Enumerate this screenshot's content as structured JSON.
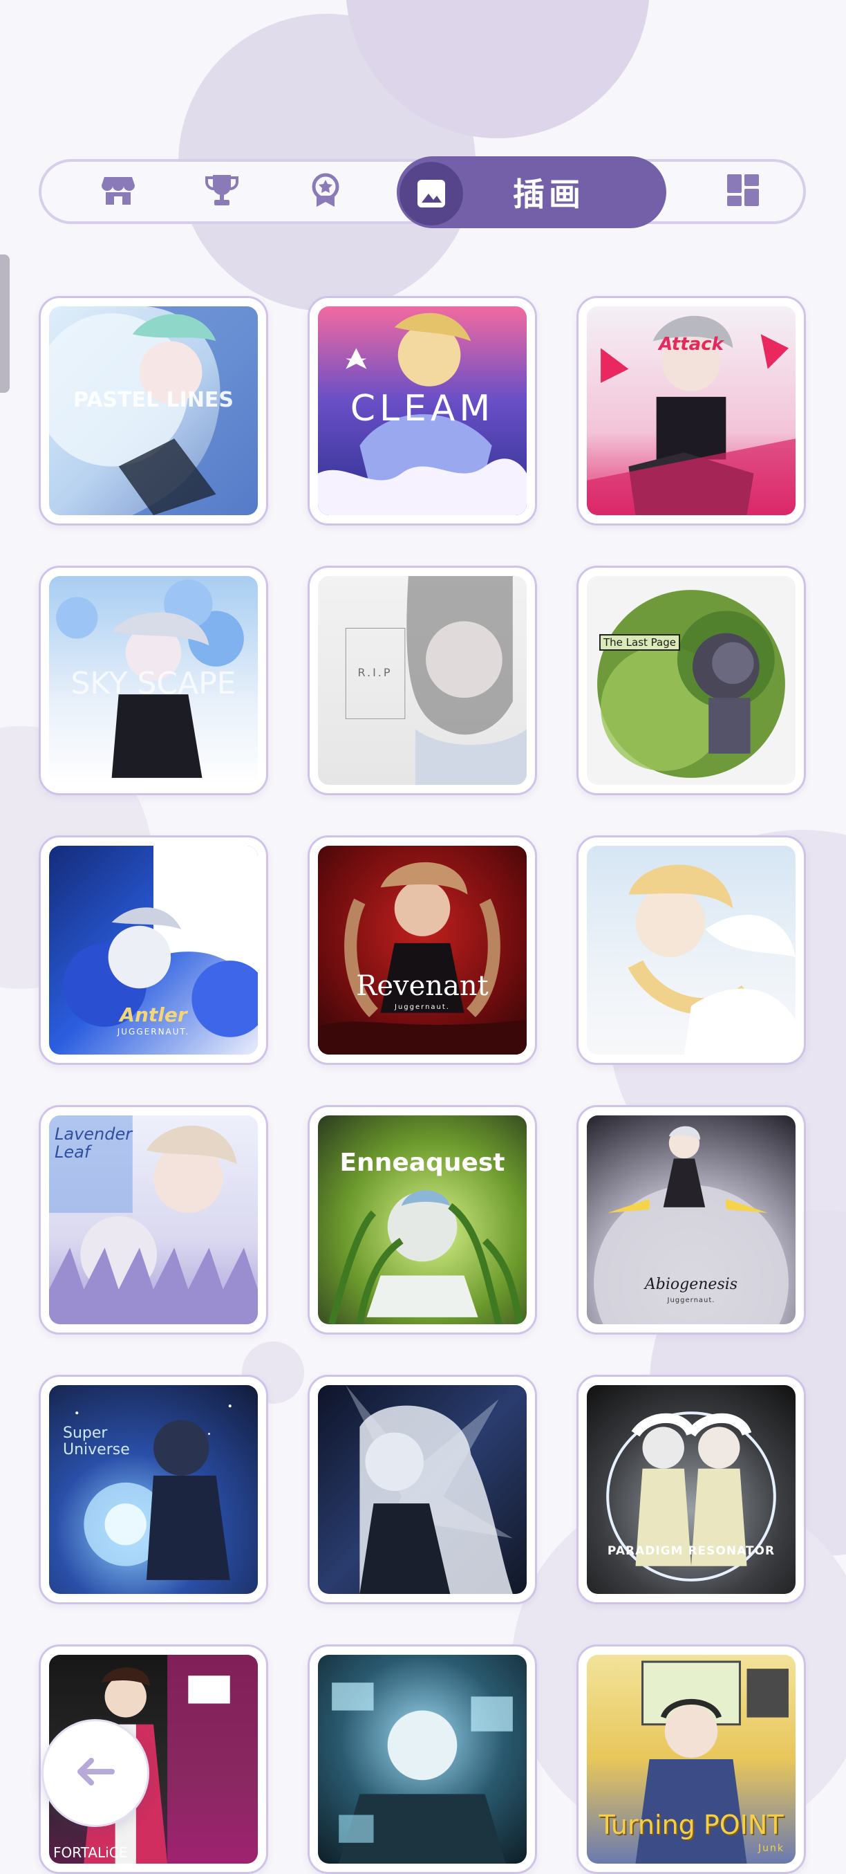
{
  "theme": {
    "accent": "#7460a8",
    "accent_dark": "#56458a",
    "card_border": "#cfc3ea",
    "nav_icon": "#8a7bb8"
  },
  "nav": {
    "items": [
      {
        "icon": "store-icon",
        "label": ""
      },
      {
        "icon": "trophy-icon",
        "label": ""
      },
      {
        "icon": "medal-icon",
        "label": ""
      },
      {
        "icon": "image-icon",
        "label": "插画",
        "active": true
      },
      {
        "icon": "dashboard-icon",
        "label": ""
      }
    ],
    "active_label": "插画"
  },
  "gallery": {
    "items": [
      {
        "title": "PASTEL LINES",
        "sub": ""
      },
      {
        "title": "CLEAM",
        "sub": ""
      },
      {
        "title": "Attack",
        "sub": ""
      },
      {
        "title": "SKY SCAPE",
        "sub": ""
      },
      {
        "title": "R.I.P",
        "sub": ""
      },
      {
        "title": "The Last Page",
        "sub": ""
      },
      {
        "title": "Antler",
        "sub": "JUGGERNAUT."
      },
      {
        "title": "Revenant",
        "sub": "Juggernaut."
      },
      {
        "title": "",
        "sub": ""
      },
      {
        "title": "Lavender Leaf",
        "sub": ""
      },
      {
        "title": "Enneaquest",
        "sub": ""
      },
      {
        "title": "Abiogenesis",
        "sub": "Juggernaut."
      },
      {
        "title": "Super Universe",
        "sub": ""
      },
      {
        "title": "",
        "sub": ""
      },
      {
        "title": "PARADIGM RESONATOR",
        "sub": ""
      },
      {
        "title": "FORTALiCE",
        "sub": ""
      },
      {
        "title": "",
        "sub": ""
      },
      {
        "title": "Turning POINT",
        "sub": "Junk"
      }
    ]
  },
  "back_button": {
    "icon": "arrow-left-icon"
  }
}
